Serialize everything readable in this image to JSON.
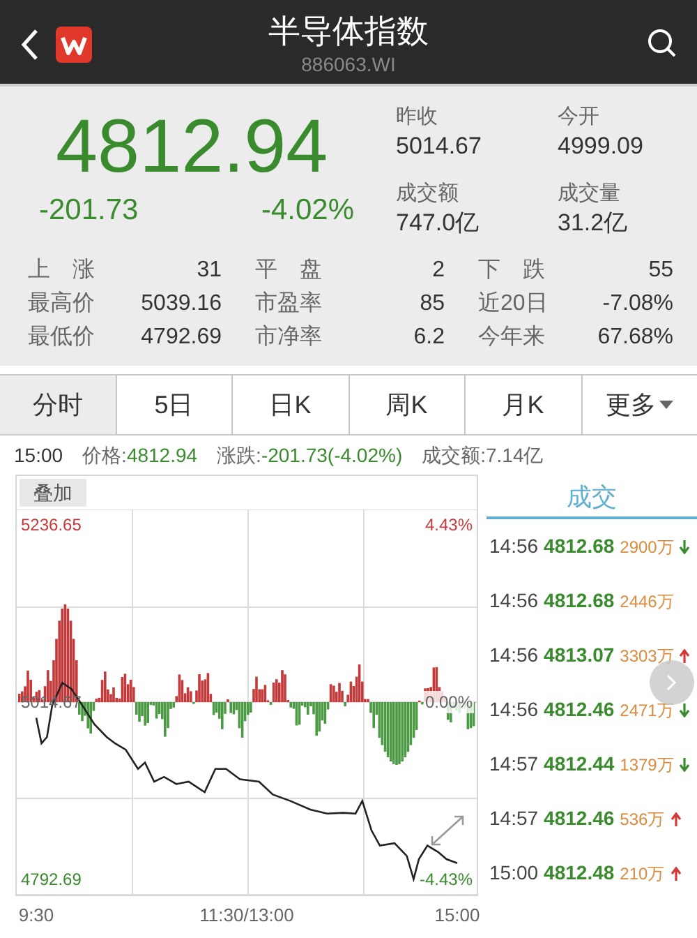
{
  "header": {
    "title": "半导体指数",
    "code": "886063.WI"
  },
  "quote": {
    "price": "4812.94",
    "change": "-201.73",
    "change_pct": "-4.02%",
    "stats": [
      {
        "label": "昨收",
        "value": "5014.67"
      },
      {
        "label": "今开",
        "value": "4999.09"
      },
      {
        "label": "成交额",
        "value": "747.0亿"
      },
      {
        "label": "成交量",
        "value": "31.2亿"
      }
    ],
    "grid": [
      {
        "label": "上　涨",
        "value": "31"
      },
      {
        "label": "平　盘",
        "value": "2"
      },
      {
        "label": "下　跌",
        "value": "55"
      },
      {
        "label": "最高价",
        "value": "5039.16"
      },
      {
        "label": "市盈率",
        "value": "85"
      },
      {
        "label": "近20日",
        "value": "-7.08%"
      },
      {
        "label": "最低价",
        "value": "4792.69"
      },
      {
        "label": "市净率",
        "value": "6.2"
      },
      {
        "label": "今年来",
        "value": "67.68%"
      }
    ]
  },
  "tabs": [
    {
      "label": "分时",
      "selected": true
    },
    {
      "label": "5日",
      "selected": false
    },
    {
      "label": "日K",
      "selected": false
    },
    {
      "label": "周K",
      "selected": false
    },
    {
      "label": "月K",
      "selected": false
    },
    {
      "label": "更多",
      "selected": false
    }
  ],
  "info_line": {
    "time": "15:00",
    "price_label": "价格:",
    "price": "4812.94",
    "change_label": "涨跌:",
    "change": "-201.73(-4.02%)",
    "amount": "成交额:7.14亿"
  },
  "chart": {
    "overlay_button": "叠加",
    "pct_labels": [
      "4.43%",
      "0.00%",
      "-4.43%"
    ],
    "chart_data": {
      "type": "line",
      "x": [
        9.5,
        9.57,
        9.64,
        9.71,
        9.84,
        9.96,
        10.1,
        10.26,
        10.42,
        10.53,
        10.67,
        10.83,
        10.92,
        11.04,
        11.17,
        11.33,
        11.49,
        11.7,
        11.84,
        11.98,
        12.16,
        12.41,
        12.59,
        12.82,
        13.08,
        13.3,
        13.51,
        13.67,
        13.76,
        13.88,
        13.99,
        14.18,
        14.34,
        14.43,
        14.5,
        14.61,
        14.75,
        14.86,
        15
      ],
      "series": [
        {
          "color": "#222222",
          "values": [
            4995,
            4963,
            4971,
            5011,
            5039,
            5031,
            5011,
            4987,
            4971,
            4963,
            4955,
            4931,
            4939,
            4915,
            4921,
            4912,
            4915,
            4902,
            4931,
            4931,
            4918,
            4915,
            4899,
            4891,
            4880,
            4875,
            4876,
            4875,
            4891,
            4854,
            4835,
            4838,
            4822,
            4793,
            4818,
            4835,
            4827,
            4818,
            4813
          ]
        }
      ],
      "xlim": [
        9.245,
        15.255
      ],
      "ylim": [
        4773.46,
        5297.83
      ],
      "xticks": [
        {
          "value": 9.5,
          "label": "9:30"
        },
        {
          "value": 12.25,
          "label": "11:30/13:00"
        },
        {
          "value": 15,
          "label": "15:00"
        }
      ],
      "yticks": [
        {
          "value": 5236.65,
          "label": "5236.65"
        },
        {
          "value": 5014.67,
          "label": "5014.67"
        },
        {
          "value": 4792.69,
          "label": "4792.69"
        }
      ]
    }
  },
  "trades_panel": {
    "title": "成交",
    "rows": [
      {
        "time": "14:56",
        "price": "4812.68",
        "volume": "2900万",
        "kind": "down"
      },
      {
        "time": "14:56",
        "price": "4812.68",
        "volume": "2446万",
        "kind": "plain"
      },
      {
        "time": "14:56",
        "price": "4813.07",
        "volume": "3303万",
        "kind": "up"
      },
      {
        "time": "14:56",
        "price": "4812.46",
        "volume": "2471万",
        "kind": "down"
      },
      {
        "time": "14:57",
        "price": "4812.44",
        "volume": "1379万",
        "kind": "down"
      },
      {
        "time": "14:57",
        "price": "4812.46",
        "volume": "536万",
        "kind": "up"
      },
      {
        "time": "15:00",
        "price": "4812.48",
        "volume": "210万",
        "kind": "up"
      }
    ]
  }
}
